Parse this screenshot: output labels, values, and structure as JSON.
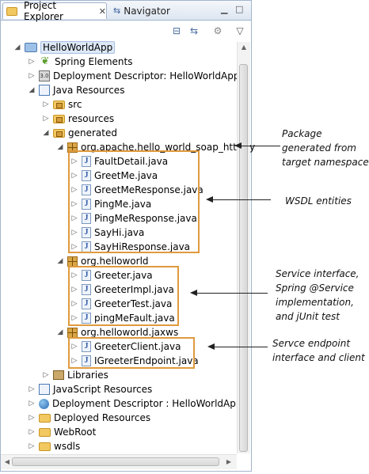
{
  "tabs": {
    "active": {
      "label": "Project Explorer",
      "close": "✕"
    },
    "inactive": {
      "label": "Navigator"
    }
  },
  "window_buttons": {
    "minimize": "▁",
    "maximize": "□"
  },
  "toolbar": {
    "collapse_icon": "collapse-all-icon",
    "link_icon": "link-editor-icon",
    "menu_icon": "view-menu-icon"
  },
  "tree": {
    "project": "HelloWorldApp",
    "items": [
      "Spring Elements",
      "Deployment Descriptor: HelloWorldApp",
      "Java Resources",
      "src",
      "resources",
      "generated",
      "org.apache.hello_world_soap_http.ty",
      "FaultDetail.java",
      "GreetMe.java",
      "GreetMeResponse.java",
      "PingMe.java",
      "PingMeResponse.java",
      "SayHi.java",
      "SayHiResponse.java",
      "org.helloworld",
      "Greeter.java",
      "GreeterImpl.java",
      "GreeterTest.java",
      "pingMeFault.java",
      "org.helloworld.jaxws",
      "GreeterClient.java",
      "IGreeterEndpoint.java",
      "Libraries",
      "JavaScript Resources",
      "Deployment Descriptor : HelloWorldApp",
      "Deployed Resources",
      "WebRoot",
      "wsdls"
    ]
  },
  "annotations": {
    "package_note": [
      "Package",
      "generated from",
      "target namespace"
    ],
    "wsdl_note": [
      "WSDL entities"
    ],
    "service_note": [
      "Service interface,",
      "Spring @Service",
      "implementation,",
      "and jUnit test"
    ],
    "endpoint_note": [
      "Servce endpoint",
      "interface and client"
    ]
  },
  "colors": {
    "highlight_box": "#e09a3e",
    "selection": "#dde8f7",
    "tab_border": "#a4b5cc"
  }
}
